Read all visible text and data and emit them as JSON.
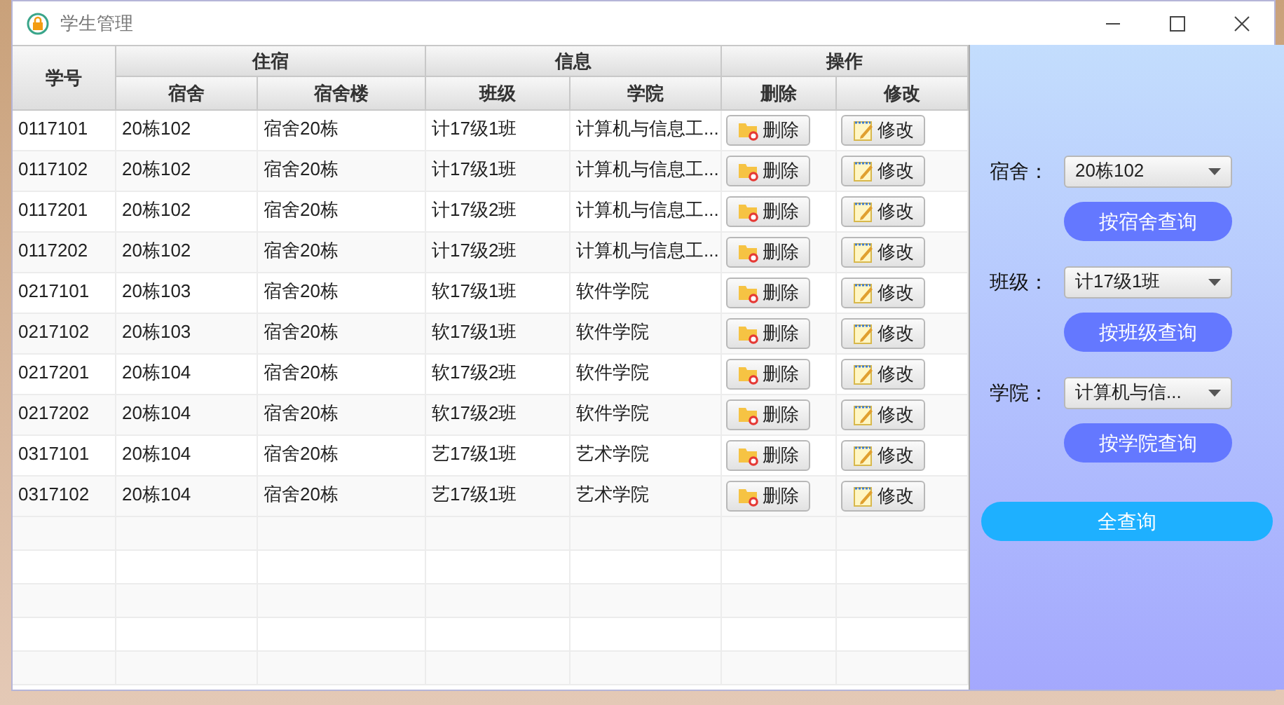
{
  "window": {
    "title": "学生管理"
  },
  "table": {
    "header": [
      {
        "kind": "single",
        "label": "学号"
      },
      {
        "kind": "group",
        "label": "住宿",
        "columns": [
          "宿舍",
          "宿舍楼"
        ]
      },
      {
        "kind": "group",
        "label": "信息",
        "columns": [
          "班级",
          "学院"
        ]
      },
      {
        "kind": "group",
        "label": "操作",
        "columns": [
          "删除",
          "修改"
        ]
      }
    ],
    "rows": [
      {
        "cells": [
          "0117101",
          "20栋102",
          "宿舍20栋",
          "计17级1班",
          "计算机与信息工..."
        ],
        "buttons": [
          "删除",
          "修改"
        ]
      },
      {
        "cells": [
          "0117102",
          "20栋102",
          "宿舍20栋",
          "计17级1班",
          "计算机与信息工..."
        ],
        "buttons": [
          "删除",
          "修改"
        ]
      },
      {
        "cells": [
          "0117201",
          "20栋102",
          "宿舍20栋",
          "计17级2班",
          "计算机与信息工..."
        ],
        "buttons": [
          "删除",
          "修改"
        ]
      },
      {
        "cells": [
          "0117202",
          "20栋102",
          "宿舍20栋",
          "计17级2班",
          "计算机与信息工..."
        ],
        "buttons": [
          "删除",
          "修改"
        ]
      },
      {
        "cells": [
          "0217101",
          "20栋103",
          "宿舍20栋",
          "软17级1班",
          "软件学院"
        ],
        "buttons": [
          "删除",
          "修改"
        ]
      },
      {
        "cells": [
          "0217102",
          "20栋103",
          "宿舍20栋",
          "软17级1班",
          "软件学院"
        ],
        "buttons": [
          "删除",
          "修改"
        ]
      },
      {
        "cells": [
          "0217201",
          "20栋104",
          "宿舍20栋",
          "软17级2班",
          "软件学院"
        ],
        "buttons": [
          "删除",
          "修改"
        ]
      },
      {
        "cells": [
          "0217202",
          "20栋104",
          "宿舍20栋",
          "软17级2班",
          "软件学院"
        ],
        "buttons": [
          "删除",
          "修改"
        ]
      },
      {
        "cells": [
          "0317101",
          "20栋104",
          "宿舍20栋",
          "艺17级1班",
          "艺术学院"
        ],
        "buttons": [
          "删除",
          "修改"
        ]
      },
      {
        "cells": [
          "0317102",
          "20栋104",
          "宿舍20栋",
          "艺17级1班",
          "艺术学院"
        ],
        "buttons": [
          "删除",
          "修改"
        ]
      }
    ]
  },
  "filters": [
    {
      "label": "宿舍：",
      "value": "20栋102",
      "button": "按宿舍查询"
    },
    {
      "label": "班级：",
      "value": "计17级1班",
      "button": "按班级查询"
    },
    {
      "label": "学院：",
      "value": "计算机与信...",
      "button": "按学院查询"
    }
  ],
  "all_button": "全查询"
}
